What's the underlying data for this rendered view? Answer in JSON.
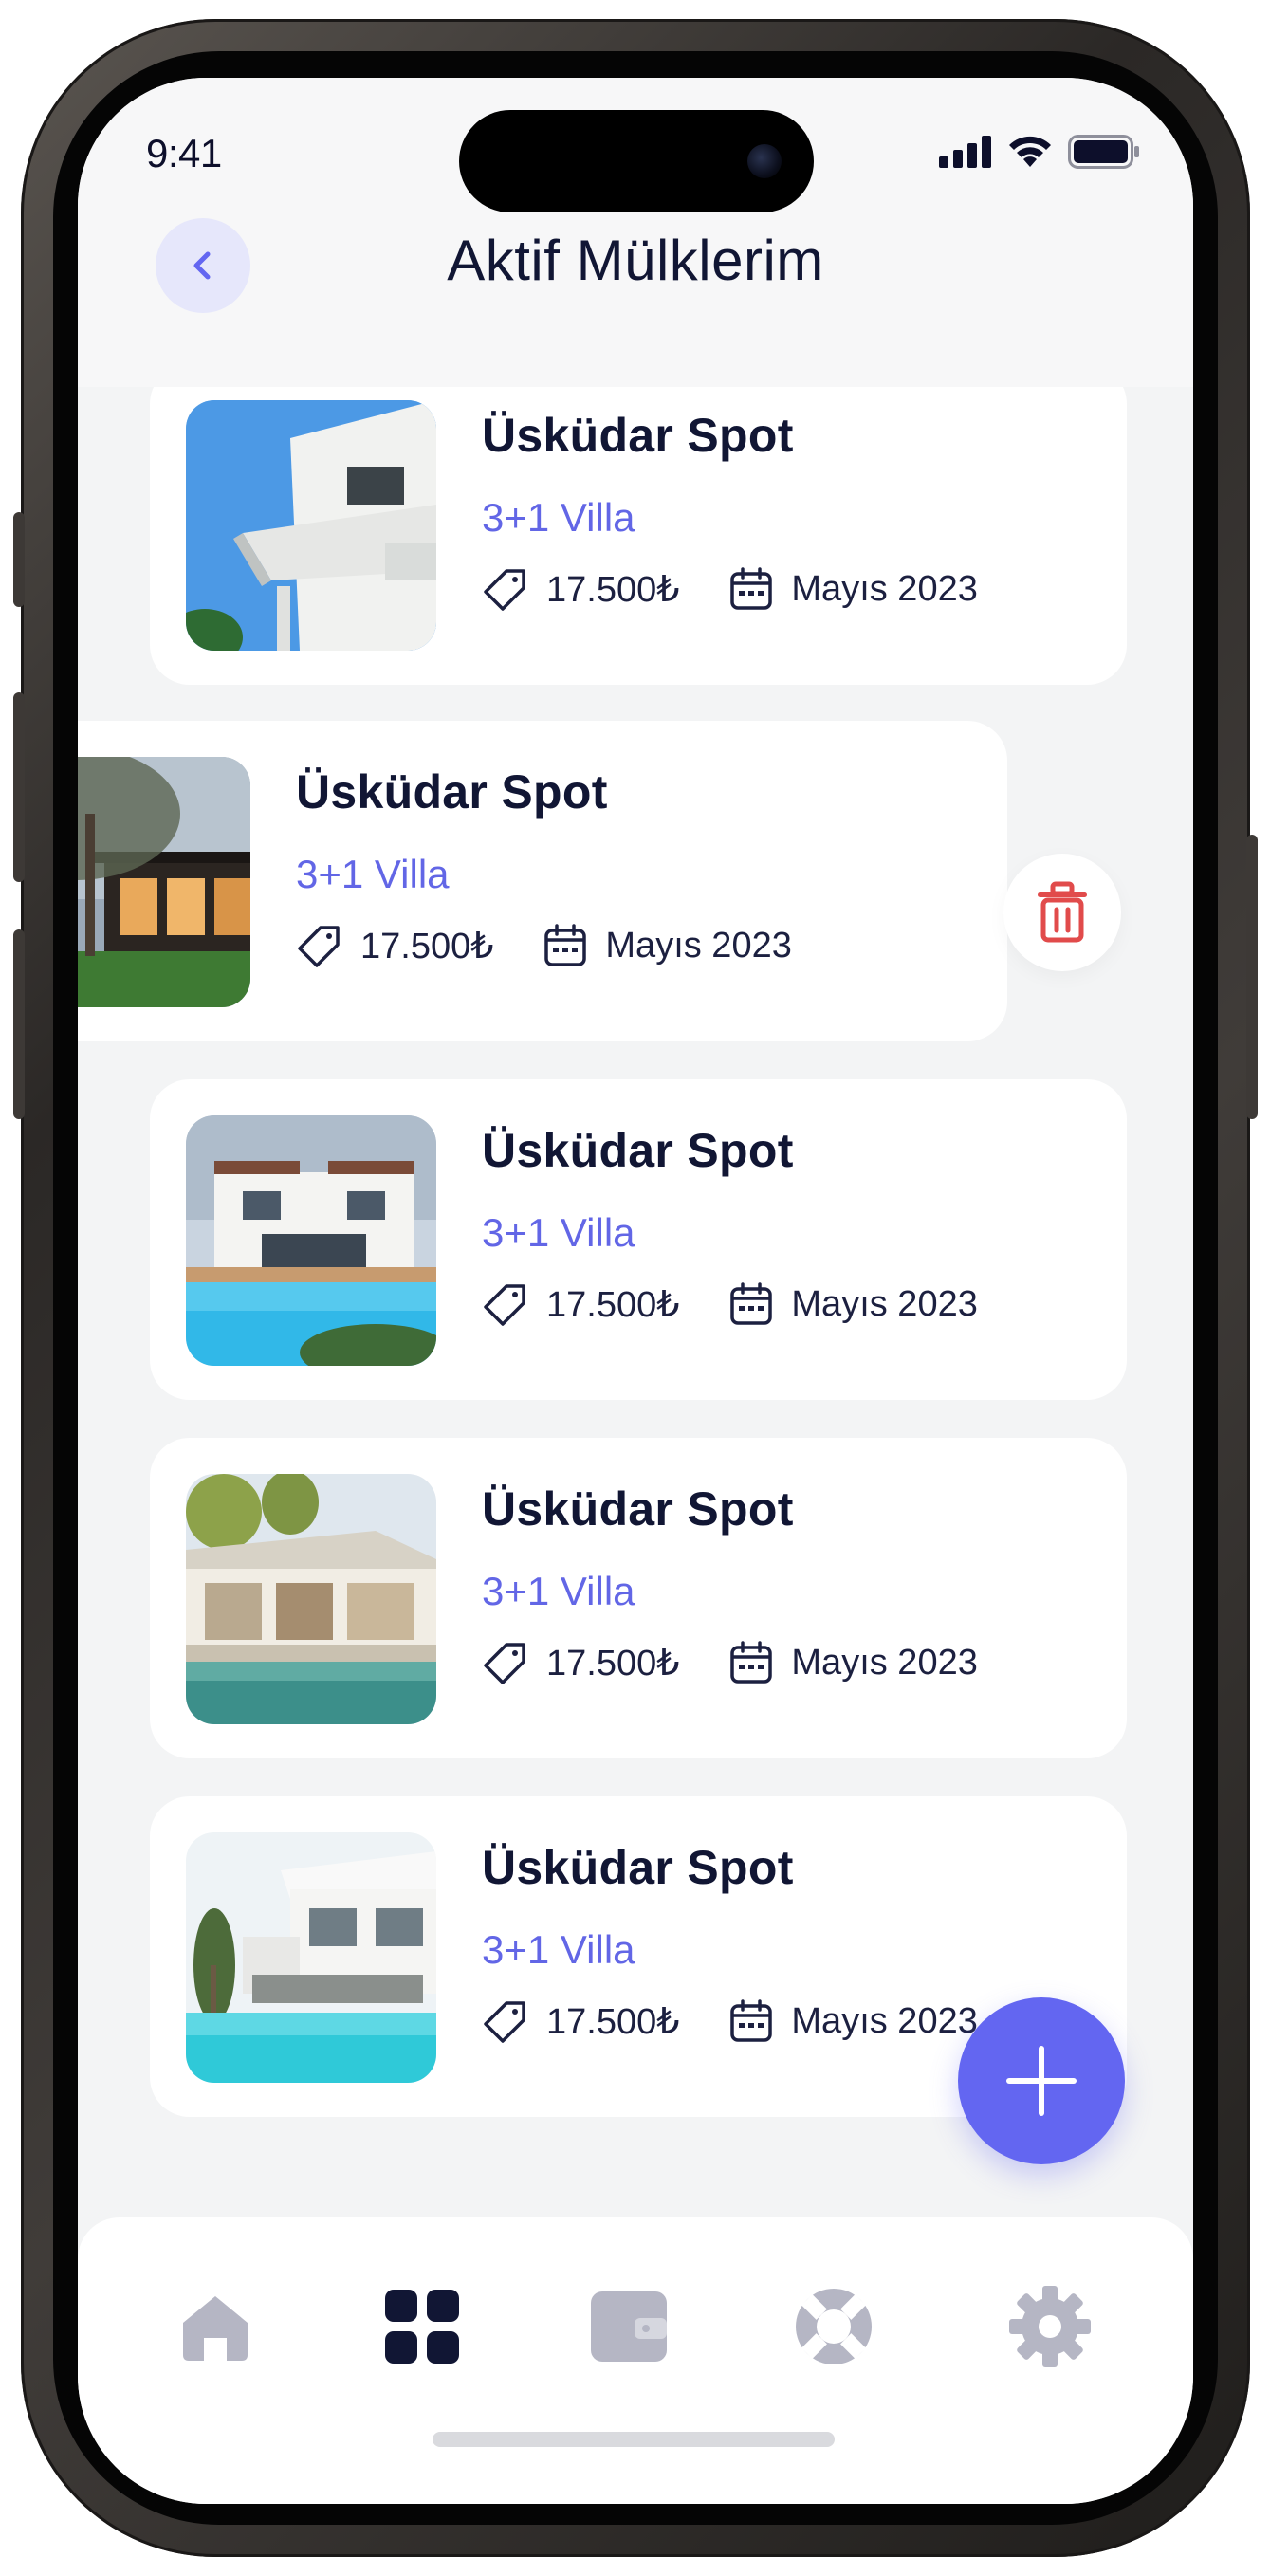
{
  "status_bar": {
    "time": "9:41"
  },
  "header": {
    "title": "Aktif Mülklerim"
  },
  "properties": [
    {
      "name": "Üsküdar Spot",
      "type": "3+1 Villa",
      "price": "17.500₺",
      "date": "Mayıs 2023"
    },
    {
      "name": "Üsküdar Spot",
      "type": "3+1 Villa",
      "price": "17.500₺",
      "date": "Mayıs 2023"
    },
    {
      "name": "Üsküdar Spot",
      "type": "3+1 Villa",
      "price": "17.500₺",
      "date": "Mayıs 2023"
    },
    {
      "name": "Üsküdar Spot",
      "type": "3+1 Villa",
      "price": "17.500₺",
      "date": "Mayıs 2023"
    },
    {
      "name": "Üsküdar Spot",
      "type": "3+1 Villa",
      "price": "17.500₺",
      "date": "Mayıs 2023"
    }
  ],
  "tab_bar": {
    "items": [
      {
        "icon": "home-icon",
        "active": false
      },
      {
        "icon": "grid-icon",
        "active": true
      },
      {
        "icon": "wallet-icon",
        "active": false
      },
      {
        "icon": "support-icon",
        "active": false
      },
      {
        "icon": "gear-icon",
        "active": false
      }
    ]
  },
  "colors": {
    "accent": "#6366f1",
    "title": "#111634",
    "danger": "#e14b4b",
    "inactive_icon": "#b5b6c4"
  }
}
